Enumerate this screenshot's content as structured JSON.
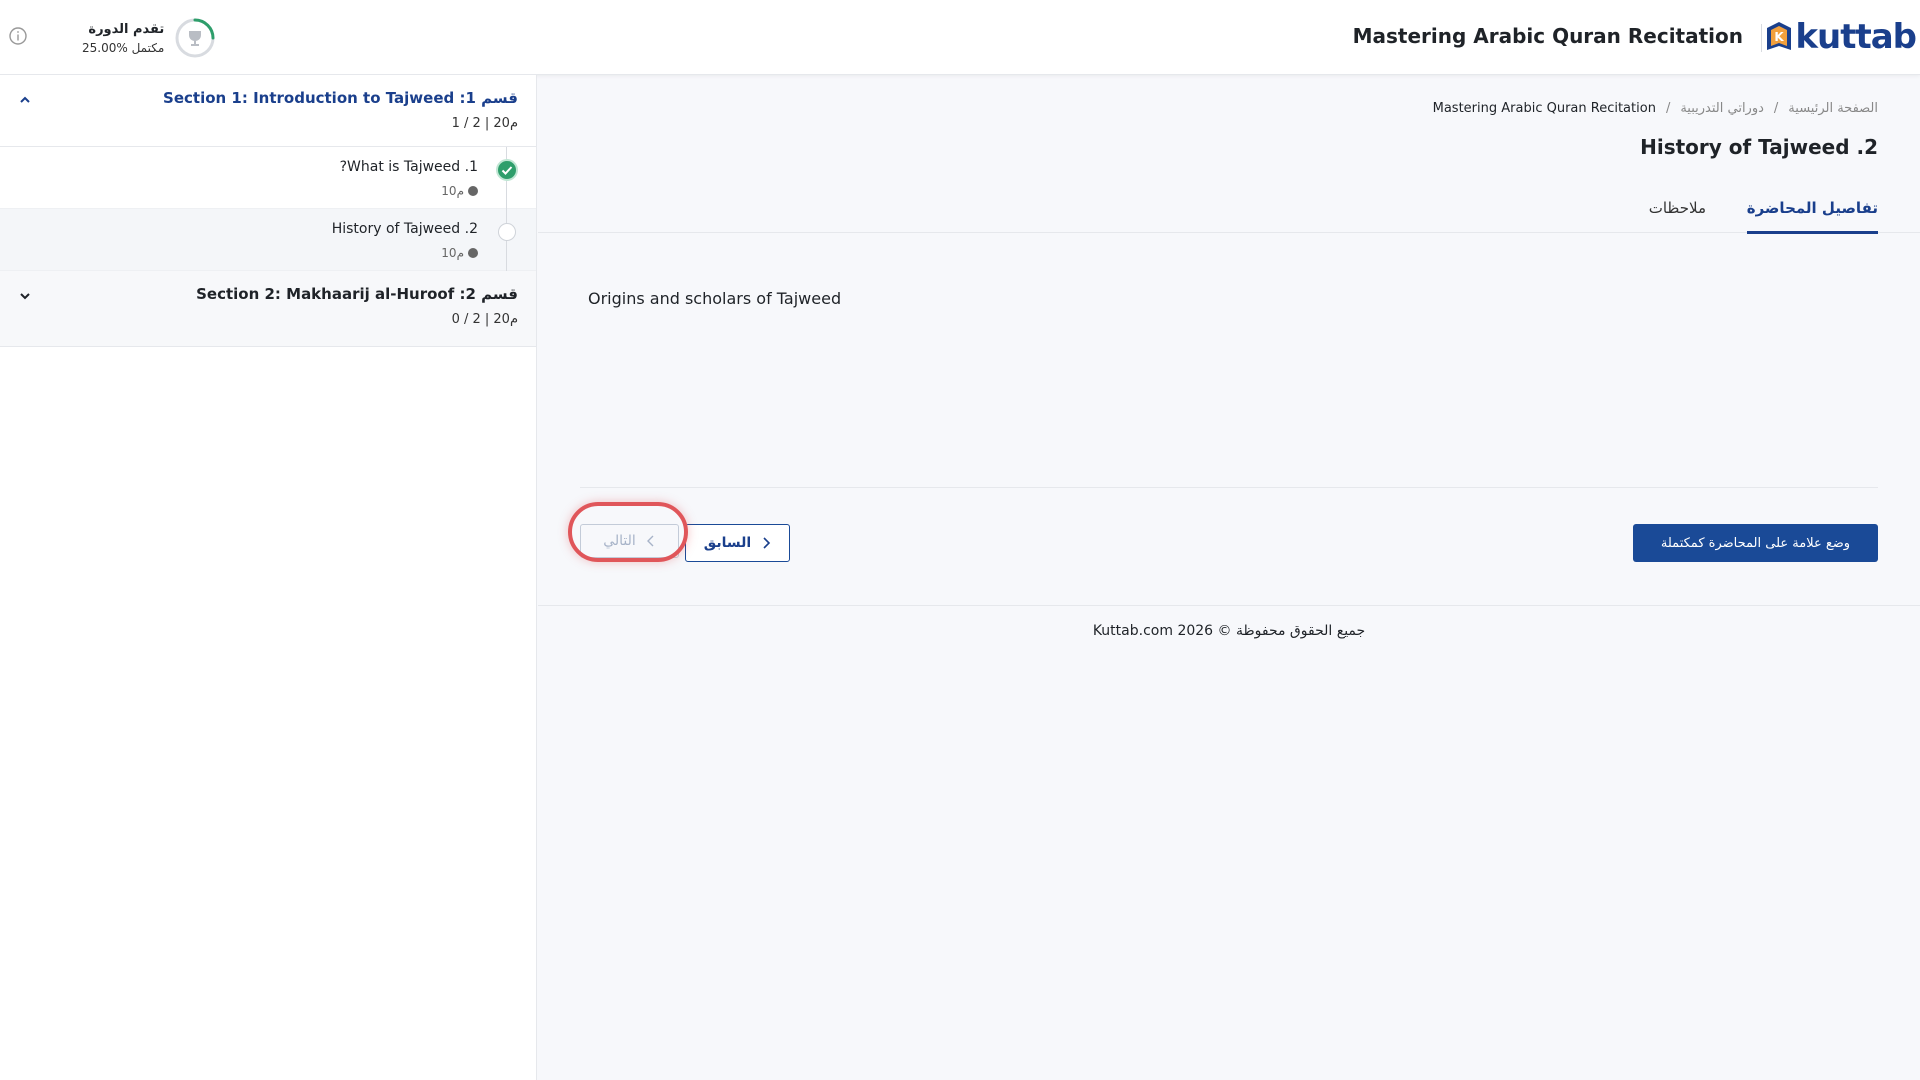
{
  "header": {
    "logo_text": "kuttab",
    "course_title": "Mastering Arabic Quran Recitation",
    "progress_label": "تقدم الدورة",
    "progress_value": "25.00% مكتمل",
    "progress_fraction": 0.25,
    "info_icon": "info-icon",
    "trophy_icon": "trophy-icon"
  },
  "sidebar": {
    "sections": [
      {
        "title": "قسم 1: Section 1: Introduction to Tajweed",
        "meta": "1 / 2 | 20م",
        "expanded": true,
        "lessons": [
          {
            "title": "1. What is Tajweed?",
            "duration": "10م",
            "completed": true
          },
          {
            "title": "2. History of Tajweed",
            "duration": "10م",
            "completed": false
          }
        ]
      },
      {
        "title": "قسم 2: Section 2: Makhaarij al-Huroof",
        "meta": "0 / 2 | 20م",
        "expanded": false
      }
    ]
  },
  "breadcrumb": {
    "home": "الصفحة الرئيسية",
    "my_courses": "دوراتي التدريبية",
    "course": "Mastering Arabic Quran Recitation"
  },
  "lecture": {
    "title": "2. History of Tajweed",
    "description": "Origins and scholars of Tajweed"
  },
  "tabs": {
    "details": "تفاصيل المحاضرة",
    "notes": "ملاحظات"
  },
  "actions": {
    "mark_complete": "وضع علامة على المحاضرة كمكتملة",
    "previous": "السابق",
    "next": "التالي"
  },
  "footer": {
    "text": "جميع الحقوق محفوظة © 2026 Kuttab.com"
  },
  "colors": {
    "brand": "#1a3f8c",
    "success": "#2e9e6b",
    "highlight": "#e0565a"
  }
}
